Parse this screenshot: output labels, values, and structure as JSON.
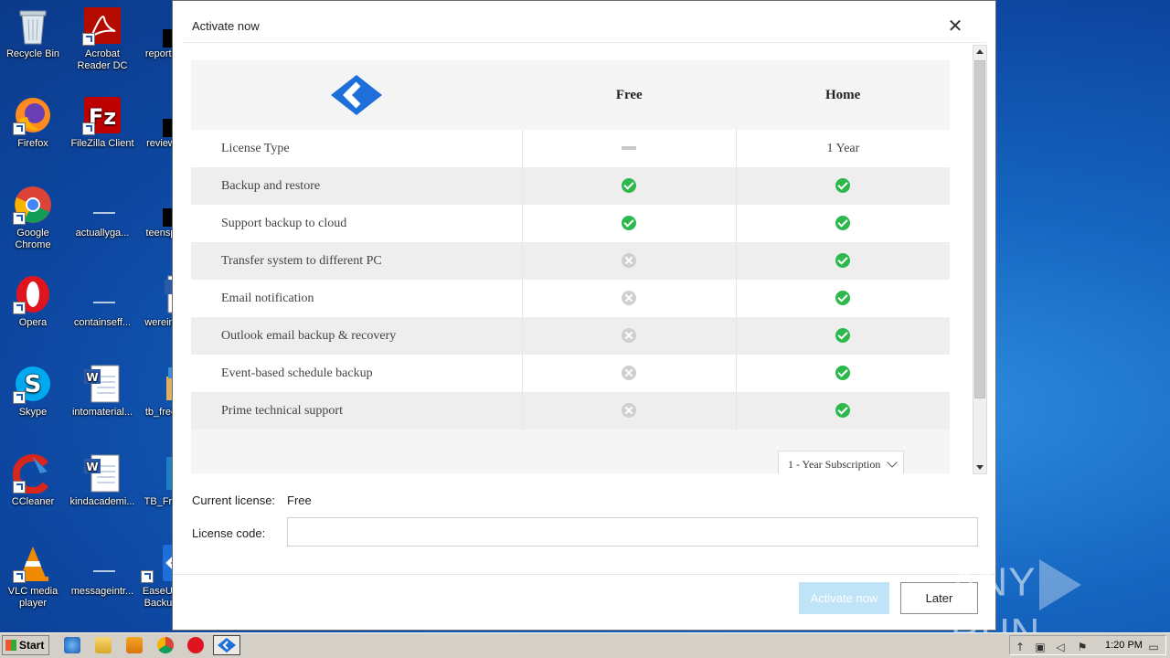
{
  "desktop": {
    "icons": [
      {
        "label": "Recycle Bin"
      },
      {
        "label": "Acrobat Reader DC"
      },
      {
        "label": "reports"
      },
      {
        "label": "Firefox"
      },
      {
        "label": "FileZilla Client"
      },
      {
        "label": "review"
      },
      {
        "label": "Google Chrome"
      },
      {
        "label": "actuallyga..."
      },
      {
        "label": "teensp"
      },
      {
        "label": "Opera"
      },
      {
        "label": "containseff..."
      },
      {
        "label": "wereint"
      },
      {
        "label": "Skype"
      },
      {
        "label": "intomaterial..."
      },
      {
        "label": "tb_free"
      },
      {
        "label": "CCleaner"
      },
      {
        "label": "kindacademi..."
      },
      {
        "label": "TB_Fre"
      },
      {
        "label": "VLC media player"
      },
      {
        "label": "messageintr..."
      },
      {
        "label": "EaseUS Backup"
      }
    ]
  },
  "dialog": {
    "title": "Activate now",
    "close_symbol": "✕",
    "table": {
      "columns": [
        "Free",
        "Home"
      ],
      "rows": [
        {
          "feature": "License Type",
          "free": "dash",
          "home": "1 Year"
        },
        {
          "feature": "Backup and restore",
          "free": "check",
          "home": "check"
        },
        {
          "feature": "Support backup to cloud",
          "free": "check",
          "home": "check"
        },
        {
          "feature": "Transfer system to different PC",
          "free": "cross",
          "home": "check"
        },
        {
          "feature": "Email notification",
          "free": "cross",
          "home": "check"
        },
        {
          "feature": "Outlook email backup & recovery",
          "free": "cross",
          "home": "check"
        },
        {
          "feature": "Event-based schedule backup",
          "free": "cross",
          "home": "check"
        },
        {
          "feature": "Prime technical support",
          "free": "cross",
          "home": "check"
        }
      ],
      "subscription_select": "1 - Year Subscription"
    },
    "current_license_label": "Current license:",
    "current_license_value": "Free",
    "license_code_label": "License code:",
    "license_code_value": "",
    "activate_button": "Activate now",
    "later_button": "Later"
  },
  "watermark": {
    "left": "ANY",
    "right": "RUN"
  },
  "taskbar": {
    "start_label": "Start",
    "clock": "1:20 PM"
  },
  "colors": {
    "check": "#2db84d",
    "cross": "#cfcfcf",
    "logo": "#1e6fd9",
    "activate_disabled": "#bfe3f7"
  }
}
